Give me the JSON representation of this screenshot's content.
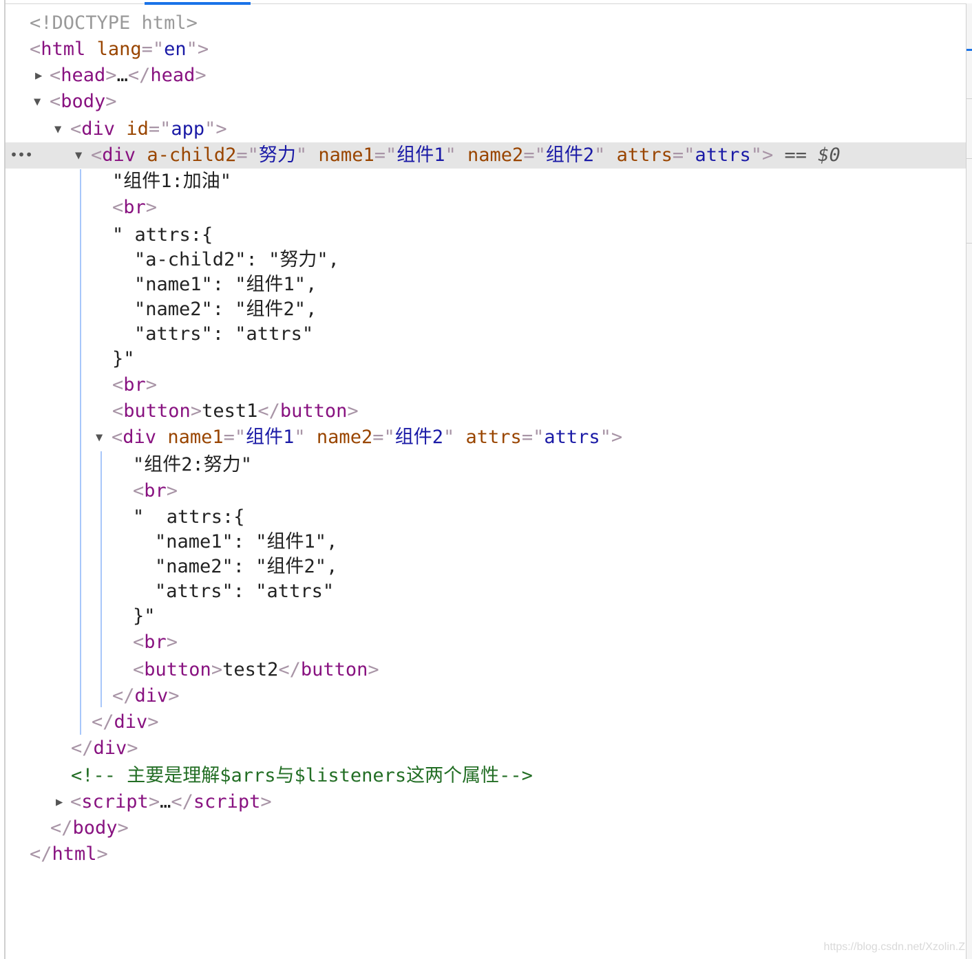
{
  "tree": {
    "doctype": "<!DOCTYPE html>",
    "html_tag": "html",
    "lang_attr": "lang",
    "lang_val": "en",
    "head_tag": "head",
    "ellipsis": "…",
    "body_tag": "body",
    "div_tag": "div",
    "id_attr": "id",
    "id_val": "app",
    "sel_attr1": "a-child2",
    "sel_val1": "努力",
    "sel_attr2": "name1",
    "sel_val2": "组件1",
    "sel_attr3": "name2",
    "sel_val3": "组件2",
    "sel_attr4": "attrs",
    "sel_val4": "attrs",
    "sel_eq": " == ",
    "sel_var": "$0",
    "text_c1": "\"组件1:加油\"",
    "br_tag": "br",
    "c1_attrs_open": "\" attrs:{",
    "c1_line1": "\"a-child2\": \"努力\",",
    "c1_line2": "\"name1\": \"组件1\",",
    "c1_line3": "\"name2\": \"组件2\",",
    "c1_line4": "\"attrs\": \"attrs\"",
    "attrs_close": "}\"",
    "button_tag": "button",
    "button1_text": "test1",
    "child_attr1": "name1",
    "child_val1": "组件1",
    "child_attr2": "name2",
    "child_val2": "组件2",
    "child_attr3": "attrs",
    "child_val3": "attrs",
    "text_c2": "\"组件2:努力\"",
    "c2_attrs_open": "\"  attrs:{",
    "c2_line1": "\"name1\": \"组件1\",",
    "c2_line2": "\"name2\": \"组件2\",",
    "c2_line3": "\"attrs\": \"attrs\"",
    "button2_text": "test2",
    "comment": "<!-- 主要是理解$arrs与$listeners这两个属性-->",
    "script_tag": "script"
  },
  "watermark": "https://blog.csdn.net/Xzolin.Z"
}
